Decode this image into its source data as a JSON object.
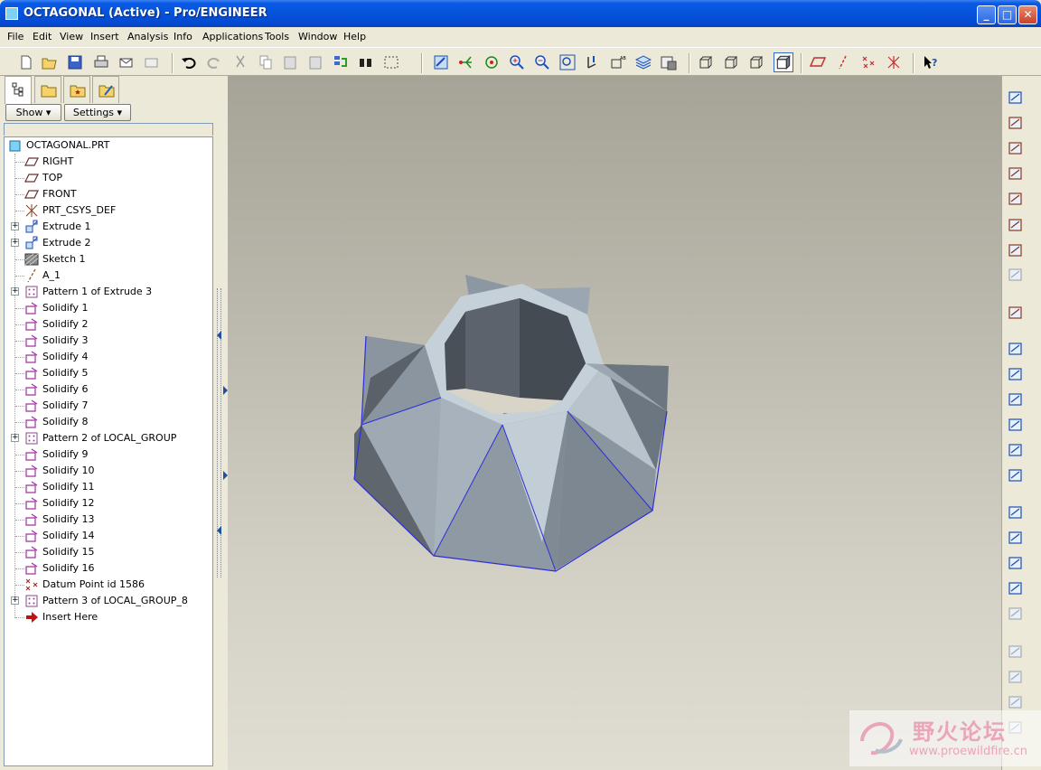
{
  "window": {
    "title": "OCTAGONAL (Active) - Pro/ENGINEER",
    "controls": {
      "minimize": "_",
      "maximize": "□",
      "close": "✕"
    }
  },
  "menu": [
    "File",
    "Edit",
    "View",
    "Insert",
    "Analysis",
    "Info",
    "Applications",
    "Tools",
    "Window",
    "Help"
  ],
  "toolbar_icons": [
    "new-icon",
    "open-icon",
    "save-icon",
    "print-icon",
    "send-mail-icon",
    "mail-attach-icon",
    "undo-icon",
    "redo-icon",
    "cut-icon",
    "copy-icon",
    "paste-icon",
    "paste-special-icon",
    "regenerate-icon",
    "find-icon",
    "select-box-icon",
    "repaint-icon",
    "spin-center-icon",
    "orient-mode-icon",
    "zoom-in-icon",
    "zoom-out-icon",
    "refit-icon",
    "reorient-icon",
    "saved-views-icon",
    "layers-icon",
    "view-manager-icon",
    "wireframe-icon",
    "hidden-line-icon",
    "no-hidden-icon",
    "shading-icon",
    "datum-plane-display-icon",
    "datum-axis-display-icon",
    "datum-point-display-icon",
    "csys-display-icon",
    "context-help-icon"
  ],
  "panel": {
    "tabs": [
      "model-tree-tab",
      "folder-browser-tab",
      "favorites-tab",
      "connections-tab"
    ],
    "show_label": "Show",
    "settings_label": "Settings"
  },
  "tree": {
    "root": "OCTAGONAL.PRT",
    "items": [
      {
        "label": "RIGHT",
        "icon": "datum-plane-icon",
        "expandable": false
      },
      {
        "label": "TOP",
        "icon": "datum-plane-icon",
        "expandable": false
      },
      {
        "label": "FRONT",
        "icon": "datum-plane-icon",
        "expandable": false
      },
      {
        "label": "PRT_CSYS_DEF",
        "icon": "csys-icon",
        "expandable": false
      },
      {
        "label": "Extrude 1",
        "icon": "extrude-icon",
        "expandable": true
      },
      {
        "label": "Extrude 2",
        "icon": "extrude-icon",
        "expandable": true
      },
      {
        "label": "Sketch 1",
        "icon": "sketch-icon",
        "expandable": false
      },
      {
        "label": "A_1",
        "icon": "datum-axis-icon",
        "expandable": false
      },
      {
        "label": "Pattern 1 of Extrude 3",
        "icon": "pattern-icon",
        "expandable": true
      },
      {
        "label": "Solidify 1",
        "icon": "solidify-icon",
        "expandable": false
      },
      {
        "label": "Solidify 2",
        "icon": "solidify-icon",
        "expandable": false
      },
      {
        "label": "Solidify 3",
        "icon": "solidify-icon",
        "expandable": false
      },
      {
        "label": "Solidify 4",
        "icon": "solidify-icon",
        "expandable": false
      },
      {
        "label": "Solidify 5",
        "icon": "solidify-icon",
        "expandable": false
      },
      {
        "label": "Solidify 6",
        "icon": "solidify-icon",
        "expandable": false
      },
      {
        "label": "Solidify 7",
        "icon": "solidify-icon",
        "expandable": false
      },
      {
        "label": "Solidify 8",
        "icon": "solidify-icon",
        "expandable": false
      },
      {
        "label": "Pattern 2 of LOCAL_GROUP",
        "icon": "pattern-icon",
        "expandable": true
      },
      {
        "label": "Solidify 9",
        "icon": "solidify-icon",
        "expandable": false
      },
      {
        "label": "Solidify 10",
        "icon": "solidify-icon",
        "expandable": false
      },
      {
        "label": "Solidify 11",
        "icon": "solidify-icon",
        "expandable": false
      },
      {
        "label": "Solidify 12",
        "icon": "solidify-icon",
        "expandable": false
      },
      {
        "label": "Solidify 13",
        "icon": "solidify-icon",
        "expandable": false
      },
      {
        "label": "Solidify 14",
        "icon": "solidify-icon",
        "expandable": false
      },
      {
        "label": "Solidify 15",
        "icon": "solidify-icon",
        "expandable": false
      },
      {
        "label": "Solidify 16",
        "icon": "solidify-icon",
        "expandable": false
      },
      {
        "label": "Datum Point id 1586",
        "icon": "datum-point-icon",
        "expandable": false
      },
      {
        "label": "Pattern 3 of LOCAL_GROUP_8",
        "icon": "pattern-icon",
        "expandable": true
      },
      {
        "label": "Insert Here",
        "icon": "insert-arrow-icon",
        "expandable": false
      }
    ]
  },
  "right_toolbar_icons": [
    "sketched-datum-curve-icon",
    "datum-plane-tool-icon",
    "datum-axis-tool-icon",
    "datum-curve-tool-icon",
    "datum-point-tool-icon",
    "csys-tool-icon",
    "analysis-feature-icon",
    "coordinate-system-offset-icon",
    "annotation-icon",
    "hole-icon",
    "shell-icon",
    "rib-icon",
    "draft-icon",
    "round-icon",
    "chamfer-icon",
    "copy-paste-icon",
    "mirror-icon",
    "merge-icon",
    "trim-icon",
    "pattern-tool-icon",
    "extend-icon",
    "offset-icon",
    "thicken-icon",
    "solidify-tool-icon"
  ],
  "watermark": {
    "text": "野火论坛",
    "url": "www.proewildfire.cn"
  },
  "colors": {
    "title_bar": "#0553db",
    "viewport_top": "#a6a397",
    "viewport_bottom": "#e0ddd3",
    "part_light": "#c9d2da",
    "part_mid": "#8a959f",
    "part_dark": "#4e555e",
    "edge_highlight": "#2b2fd9"
  }
}
